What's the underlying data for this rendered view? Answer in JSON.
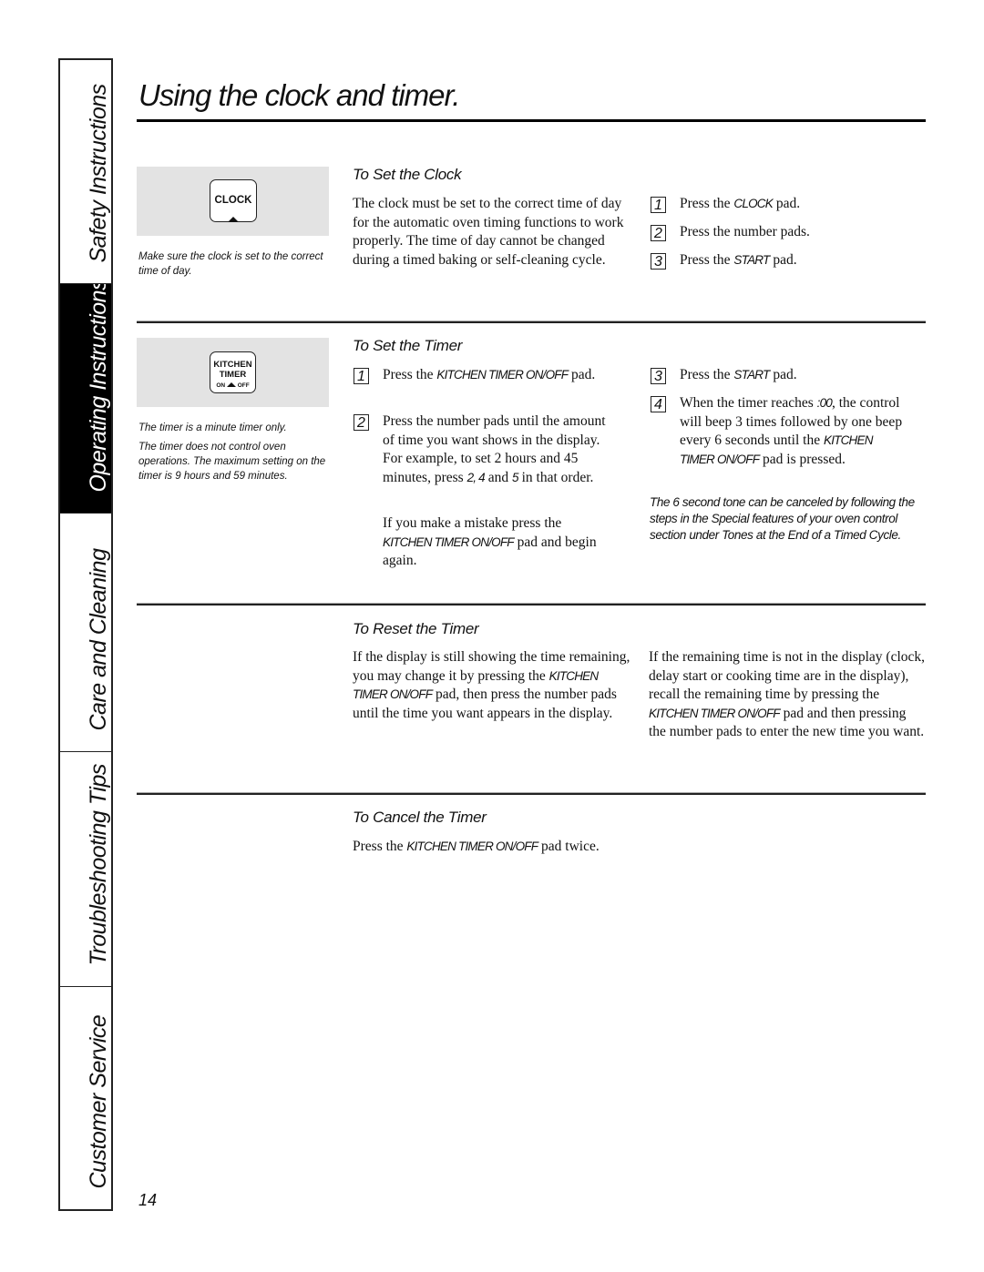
{
  "sidebar": {
    "tabs": [
      {
        "label": "Safety Instructions",
        "active": false
      },
      {
        "label": "Operating Instructions",
        "active": true
      },
      {
        "label": "Care and Cleaning",
        "active": false
      },
      {
        "label": "Troubleshooting Tips",
        "active": false
      },
      {
        "label": "Customer Service",
        "active": false
      }
    ]
  },
  "page": {
    "title": "Using the clock and timer.",
    "number": "14"
  },
  "clock_section": {
    "heading": "To Set the Clock",
    "pad_label": "CLOCK",
    "caption": "Make sure the clock is set to the correct time of day.",
    "body": "The clock must be set to the correct time of day for the automatic oven timing functions to work properly. The time of day cannot be changed during a timed baking or self-cleaning cycle.",
    "steps": [
      {
        "num": "1",
        "pre": "Press the ",
        "em": "CLOCK",
        "post": " pad."
      },
      {
        "num": "2",
        "pre": "Press the number pads.",
        "em": "",
        "post": ""
      },
      {
        "num": "3",
        "pre": "Press the ",
        "em": "START",
        "post": " pad."
      }
    ]
  },
  "timer_section": {
    "heading": "To Set the Timer",
    "pad_line1": "KITCHEN",
    "pad_line2": "TIMER",
    "pad_on": "ON",
    "pad_off": "OFF",
    "caption1": "The timer is a minute timer only.",
    "caption2": "The timer does not control oven operations. The maximum setting on the timer is 9 hours and 59 minutes.",
    "step1": {
      "num": "1",
      "pre": "Press the ",
      "em": "KITCHEN TIMER ON/OFF",
      "post": " pad."
    },
    "step2": {
      "num": "2",
      "pre": "Press the number pads until the amount of time you want shows in the display. For example, to set 2 hours and 45 minutes, press ",
      "em1": "2, 4",
      "mid": " and ",
      "em2": "5",
      "post": " in that order."
    },
    "mistake": {
      "pre": "If you make a mistake press the ",
      "em": "KITCHEN TIMER ON/OFF",
      "post": " pad and begin again."
    },
    "step3": {
      "num": "3",
      "pre": "Press the ",
      "em": "START",
      "post": " pad."
    },
    "step4": {
      "num": "4",
      "pre": "When the timer reaches ",
      "em1": ":00",
      "mid": ", the control will beep 3 times followed by one beep every 6 seconds until the ",
      "em2": "KITCHEN TIMER ON/OFF",
      "post": " pad is pressed."
    },
    "note": "The 6 second tone can be canceled by following the steps in the Special features of your oven control section under Tones at the End of a Timed Cycle."
  },
  "reset_section": {
    "heading": "To Reset the Timer",
    "col1": {
      "pre": "If the display is still showing the time remaining, you may change it by pressing the ",
      "em": "KITCHEN TIMER ON/OFF",
      "post": " pad, then press the number pads until the time you want appears in the display."
    },
    "col2": {
      "pre": "If the remaining time is not in the display (clock, delay start or cooking time are in the display), recall the remaining time by pressing the ",
      "em": "KITCHEN TIMER ON/OFF",
      "post": " pad and then pressing the number pads to enter the new time you want."
    }
  },
  "cancel_section": {
    "heading": "To Cancel the Timer",
    "body": {
      "pre": "Press the ",
      "em": "KITCHEN TIMER ON/OFF",
      "post": " pad twice."
    }
  }
}
